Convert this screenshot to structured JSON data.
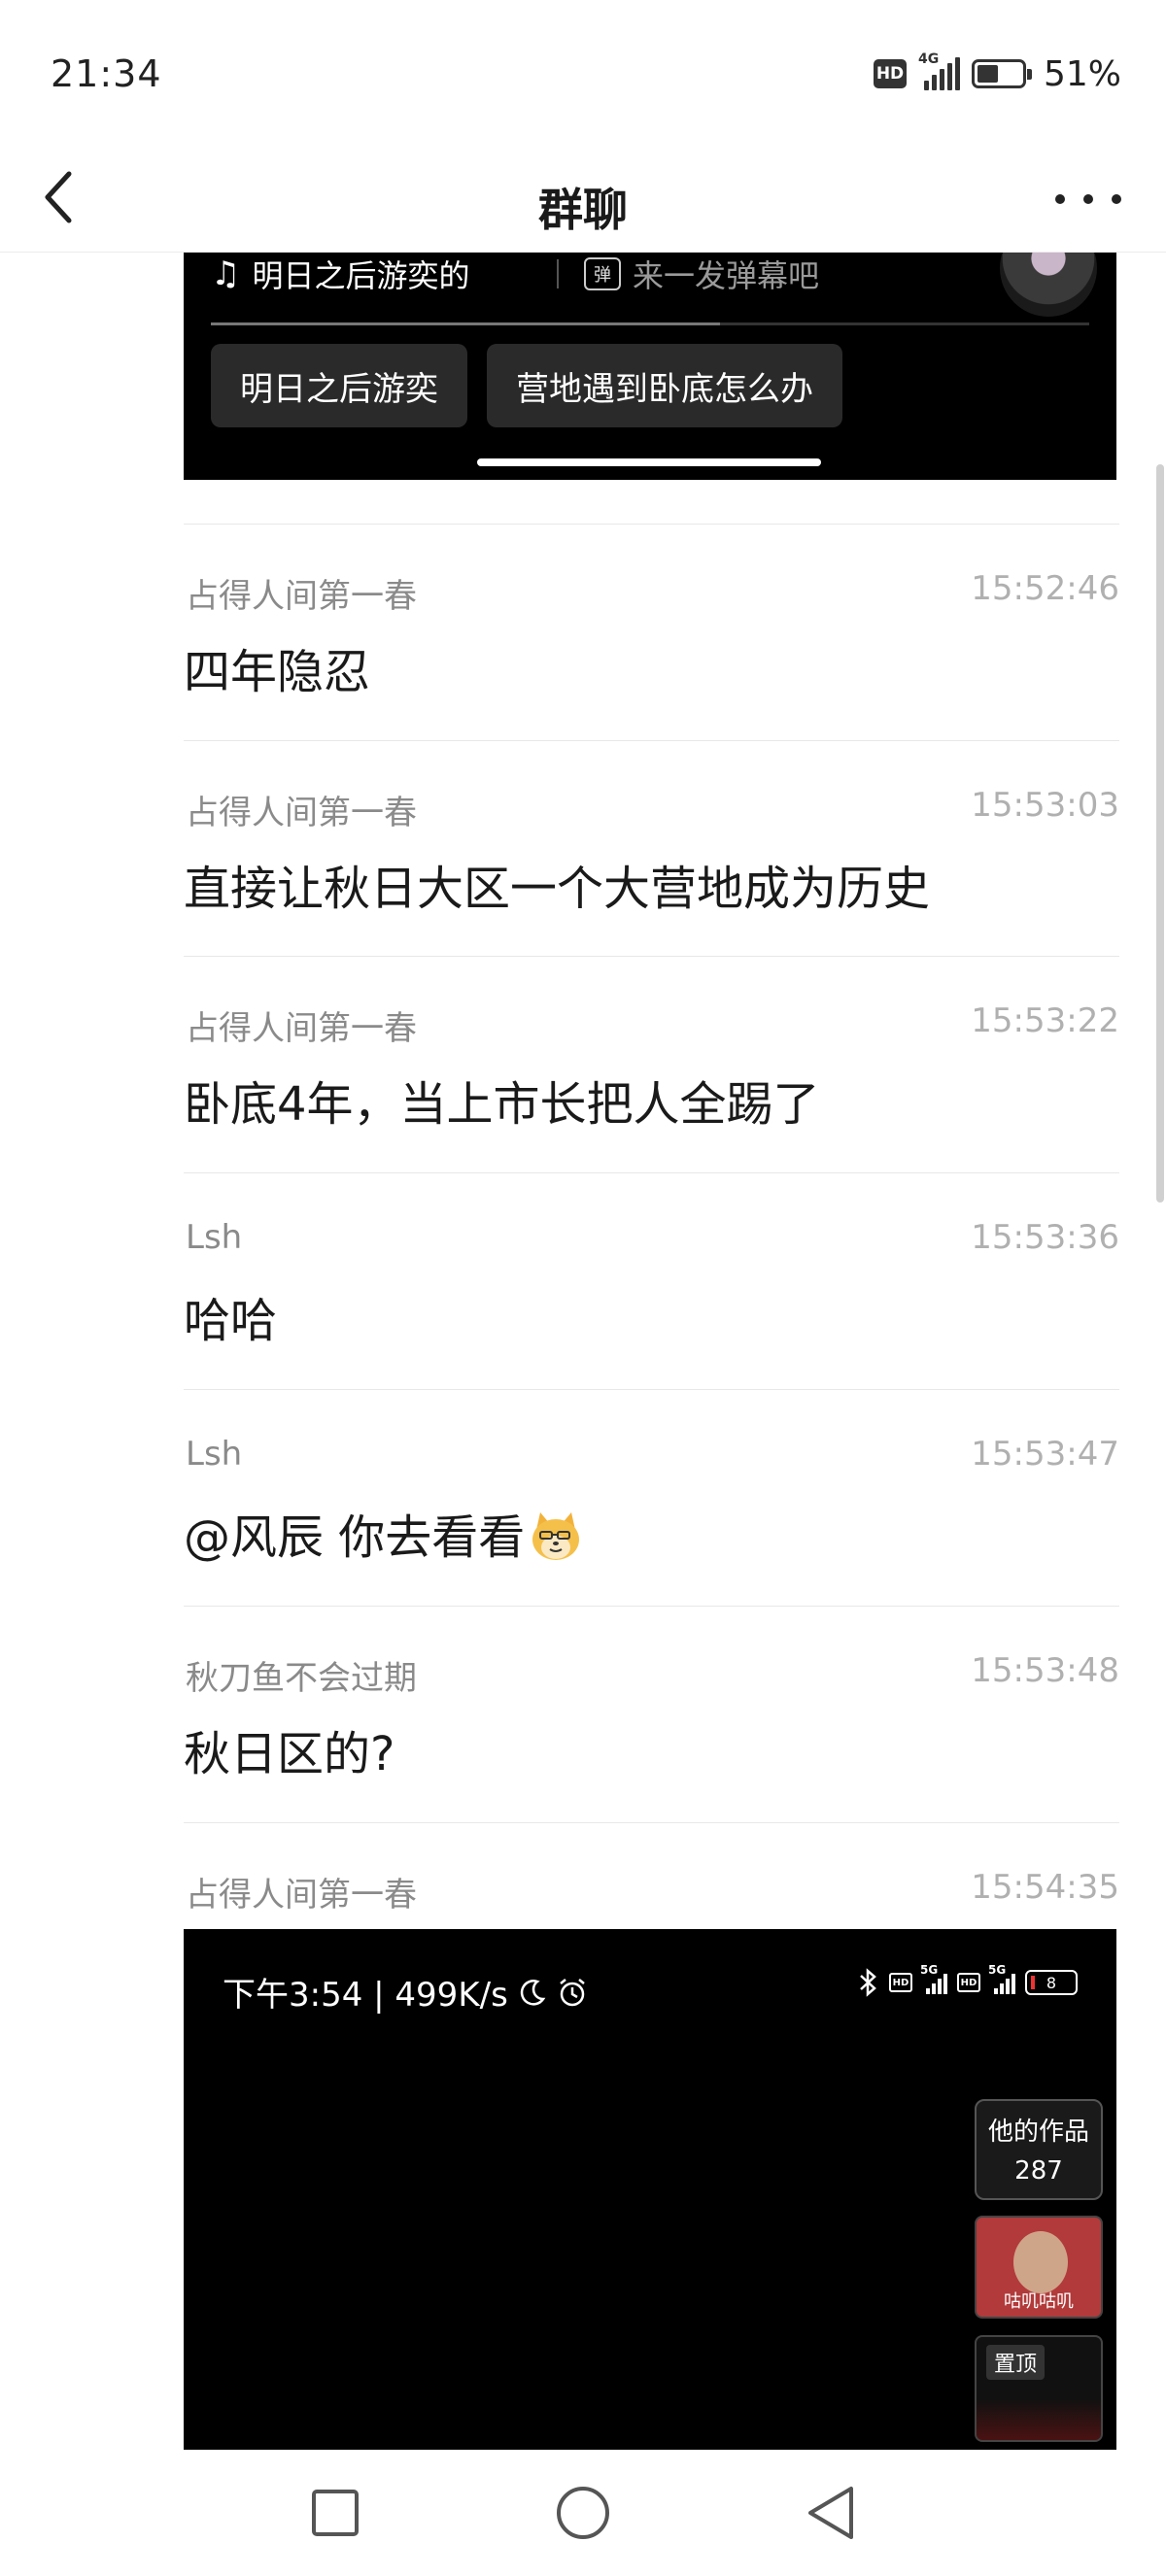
{
  "status_bar": {
    "time": "21:34",
    "hd": "HD",
    "network": "4G",
    "battery_level": 0.51,
    "battery_percent": "51%"
  },
  "header": {
    "title": "群聊",
    "back_icon": "chevron-left-icon",
    "more_icon": "more-dots-icon"
  },
  "video_card": {
    "music_title": "明日之后游奕的",
    "danmu_icon_text": "弹",
    "danmu_placeholder": "来一发弹幕吧",
    "tags": [
      "明日之后游奕",
      "营地遇到卧底怎么办"
    ]
  },
  "messages": [
    {
      "sender": "占得人间第一春",
      "time": "15:52:46",
      "text": "四年隐忍"
    },
    {
      "sender": "占得人间第一春",
      "time": "15:53:03",
      "text": "直接让秋日大区一个大营地成为历史"
    },
    {
      "sender": "占得人间第一春",
      "time": "15:53:22",
      "text": "卧底4年，当上市长把人全踢了"
    },
    {
      "sender": "Lsh",
      "time": "15:53:36",
      "text": "哈哈"
    },
    {
      "sender": "Lsh",
      "time": "15:53:47",
      "text": "@风辰 你去看看",
      "emoji": "doge-emoji"
    },
    {
      "sender": "秋刀鱼不会过期",
      "time": "15:53:48",
      "text": "秋日区的?"
    },
    {
      "sender": "占得人间第一春",
      "time": "15:54:35",
      "text": ""
    }
  ],
  "screenshot_message": {
    "status_left": "下午3:54 | 499K/s",
    "status_icons": [
      "moon-icon",
      "alarm-icon",
      "bluetooth-icon",
      "hd-icon",
      "5g-signal-icon",
      "hd-icon",
      "5g-signal-icon",
      "battery-icon"
    ],
    "network_label": "5G",
    "hd_label": "HD",
    "battery_text": "8",
    "works_label": "他的作品",
    "works_count": "287",
    "thumb_caption": "咕叽咕叽",
    "pinned_label": "置顶"
  },
  "nav_bar": {
    "buttons": [
      "recents-square-icon",
      "home-circle-icon",
      "back-triangle-icon"
    ]
  }
}
